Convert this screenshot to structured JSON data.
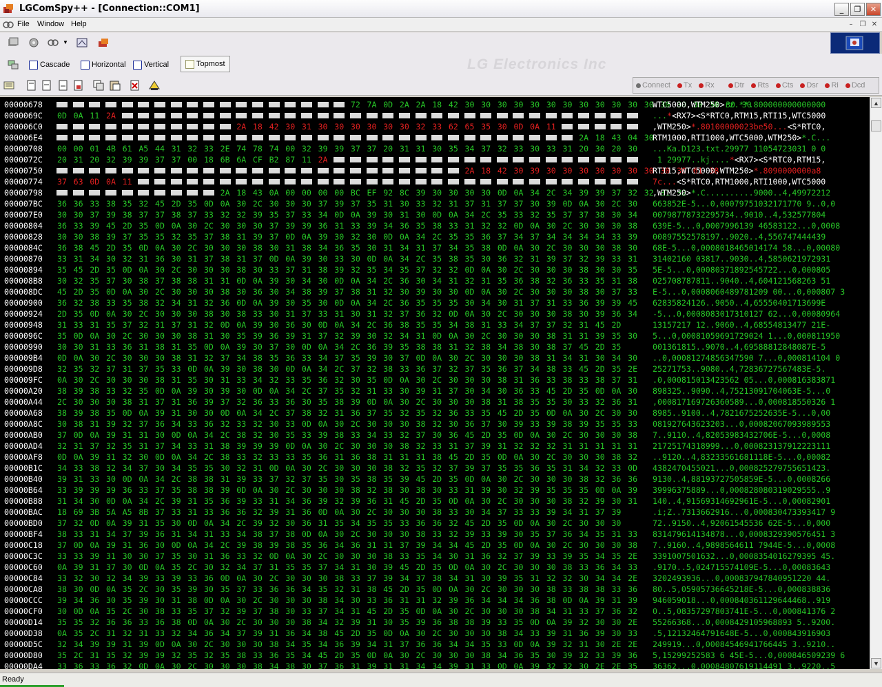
{
  "window": {
    "title": "LGComSpy++ - [Connection::COM1]"
  },
  "menu": {
    "items": [
      "File",
      "Window",
      "Help"
    ]
  },
  "toolbar2": {
    "cascade": "Cascade",
    "horizontal": "Horizontal",
    "vertical": "Vertical",
    "topmost": "Topmost",
    "watermark": "LG Electronics Inc"
  },
  "signals": [
    "Connect",
    "Tx",
    "Rx",
    "Dtr",
    "Rts",
    "Cts",
    "Dsr",
    "Ri",
    "Dcd"
  ],
  "status": {
    "text": "Ready"
  },
  "colors": {
    "hex_default": "#27c627",
    "hex_highlight": "#e32020",
    "offset": "#ffffff",
    "background": "#000000"
  },
  "terminal_rows": [
    {
      "offset": "00000678",
      "hex": "__ __ __ __ __ __ __ __ __ __ __ __ __ __ __ __ __ __ g72 g7A g0D g2A g2A g18 g42 g30 g30 g30 g30 g30 g30 g30 g30 g30 g30 g30 g30 g30 g30 g30 g30 g30 g30",
      "ascii": [
        {
          "t": "WTC5000,WTM250>",
          "c": "w"
        },
        {
          "t": "rz.**.800000000000000",
          "c": "g"
        }
      ]
    },
    {
      "offset": "0000069C",
      "hex": "g0D g0A g11 r2A __ __ __ __ __ __ __ __ __ __ __ __ __ __ __ __ __ __ __ __ __ __ __ __ __ __ __ __ __ __ __ __",
      "ascii": [
        {
          "t": "...",
          "c": "g"
        },
        {
          "t": "*",
          "c": "r"
        },
        {
          "t": "<RX7><S*RTC0,RTM15,RTI15,WTC5000",
          "c": "w"
        }
      ]
    },
    {
      "offset": "000006C0",
      "hex": "__ __ __ __ __ __ __ __ __ __ __ r2A r18 r42 r30 r31 r30 r30 r30 r30 r30 r30 r32 r33 r62 r65 r35 r30 r0D r0A r11 __ __ __ __ __",
      "ascii": [
        {
          "t": ",WTM250>",
          "c": "w"
        },
        {
          "t": "*.80100000023be50...",
          "c": "r"
        },
        {
          "t": "<S*RTC0,",
          "c": "w"
        }
      ]
    },
    {
      "offset": "000006E4",
      "hex": "__ __ __ __ __ __ __ __ __ __ __ __ __ __ __ __ __ __ __ __ __ __ __ __ __ __ __ __ __ __ __ __ g2A g18 g43 g04 g30",
      "ascii": [
        {
          "t": "RTM1000,RTI1000,WTC5000,WTM250>",
          "c": "w"
        },
        {
          "t": "*.C...",
          "c": "g"
        }
      ]
    },
    {
      "offset": "00000708",
      "hex": "g00 g00 g01 g4B g61 gA5 g44 g31 g32 g33 g2E g74 g78 g74 g00 g32 g39 g39 g37 g37 g20 g31 g31 g30 g35 g34 g37 g32 g33 g30 g33 g31 g20 g30 g20 g30",
      "ascii": [
        {
          "t": "...Ka.D123.txt.29977 11054723031 0 0",
          "c": "g"
        }
      ]
    },
    {
      "offset": "0000072C",
      "hex": "g20 g31 g20 g32 g39 g39 g37 g37 g00 g18 g6B g6A gCF gB2 g87 g11 r2A __ __ __ __ __ __ __ __ __ __ __ __ __ __ __ __ __ __ __",
      "ascii": [
        {
          "t": " 1 29977..kj....",
          "c": "g"
        },
        {
          "t": "*",
          "c": "r"
        },
        {
          "t": "<RX7><S*RTC0,RTM15,",
          "c": "w"
        }
      ]
    },
    {
      "offset": "00000750",
      "hex": "__ __ __ __ __ __ __ __ __ __ __ __ __ __ __ __ __ __ __ __ __ __ __ __ __ r2A r18 r42 r30 r39 r30 r30 r30 r30 r30 r30 r30 r30 r30 r61 r38",
      "ascii": [
        {
          "t": "RTI15,WTC5000,WTM250>",
          "c": "w"
        },
        {
          "t": "*.8090000000a8",
          "c": "r"
        }
      ]
    },
    {
      "offset": "00000774",
      "hex": "r37 r63 r0D r0A r11 __ __ __ __ __ __ __ __ __ __ __ __ __ __ __ __ __ __ __ __ __ __ __ __ __ __ __ __ __ __ __",
      "ascii": [
        {
          "t": "7c...",
          "c": "r"
        },
        {
          "t": "<S*RTC0,RTM1000,RTI1000,WTC5000",
          "c": "w"
        }
      ]
    },
    {
      "offset": "00000798",
      "hex": "__ __ __ __ __ __ __ __ __ __ g2A g18 g43 g0A g00 g00 g00 g00 gBC gEF g92 g8C g39 g30 g30 g30 g30 g0D g0A g34 g2C g34 g39 g39 g37 g32 g32 g31 g32",
      "ascii": [
        {
          "t": ",WTM250>",
          "c": "w"
        },
        {
          "t": "*.C..........9000..4,49972212",
          "c": "g"
        }
      ]
    },
    {
      "offset": "000007BC",
      "hex": "g36 g36 g33 g38 g35 g32 g45 g2D g35 g0D g0A g30 g2C g30 g30 g30 g37 g39 g37 g35 g31 g30 g33 g32 g31 g37 g31 g37 g37 g30 g39 g0D g0A g30 g2C g30",
      "ascii": [
        {
          "t": "663852E-5...0,00079751032171770 9..0,0",
          "c": "g"
        }
      ]
    },
    {
      "offset": "000007E0",
      "hex": "g30 g30 g37 g39 g38 g37 g37 g38 g37 g33 g32 g32 g39 g35 g37 g33 g34 g0D g0A g39 g30 g31 g30 g0D g0A g34 g2C g35 g33 g32 g35 g37 g37 g38 g30 g34",
      "ascii": [
        {
          "t": "00798778732295734..9010..4,532577804",
          "c": "g"
        }
      ]
    },
    {
      "offset": "00000804",
      "hex": "g36 g33 g39 g45 g2D g35 g0D g0A g30 g2C g30 g30 g30 g37 g39 g39 g36 g31 g33 g39 g34 g36 g35 g38 g33 g31 g32 g32 g0D g0A g30 g2C g30 g30 g30 g38",
      "ascii": [
        {
          "t": "639E-5...0,0007996139 46583122...0,0008",
          "c": "g"
        }
      ]
    },
    {
      "offset": "00000828",
      "hex": "g30 g30 g38 g39 g37 g35 g35 g32 g35 g37 g38 g31 g39 g37 g0D g0A g39 g30 g32 g30 g0D g0A g34 g2C g35 g35 g36 g37 g34 g37 g34 g34 g34 g34 g33 g39",
      "ascii": [
        {
          "t": "00897552578197..9020..4,556747444439",
          "c": "g"
        }
      ]
    },
    {
      "offset": "0000084C",
      "hex": "g36 g38 g45 g2D g35 g0D g0A g30 g2C g30 g30 g30 g38 g30 g31 g38 g34 g36 g35 g30 g31 g34 g31 g37 g34 g35 g38 g0D g0A g30 g2C g30 g30 g30 g38 g30",
      "ascii": [
        {
          "t": "68E-5...0,0008018465014174 58...0,00080",
          "c": "g"
        }
      ]
    },
    {
      "offset": "00000870",
      "hex": "g33 g31 g34 g30 g32 g31 g36 g30 g31 g37 g38 g31 g37 g0D g0A g39 g30 g33 g30 g0D g0A g34 g2C g35 g38 g35 g30 g36 g32 g31 g39 g37 g32 g39 g33 g31",
      "ascii": [
        {
          "t": "31402160 03817..9030..4,5850621972931",
          "c": "g"
        }
      ]
    },
    {
      "offset": "00000894",
      "hex": "g35 g45 g2D g35 g0D g0A g30 g2C g30 g30 g30 g38 g30 g33 g37 g31 g38 g39 g32 g35 g34 g35 g37 g32 g32 g0D g0A g30 g2C g30 g30 g30 g38 g30 g30 g35",
      "ascii": [
        {
          "t": "5E-5...0,00080371892545722...0,000805",
          "c": "g"
        }
      ]
    },
    {
      "offset": "000008B8",
      "hex": "g30 g32 g35 g37 g30 g38 g37 g38 g38 g31 g31 g0D g0A g39 g30 g34 g30 g0D g0A g34 g2C g36 g30 g34 g31 g32 g31 g35 g36 g38 g32 g36 g33 g35 g31 g38",
      "ascii": [
        {
          "t": "025708787811..9040..4,604121568263 51",
          "c": "g"
        }
      ]
    },
    {
      "offset": "000008DC",
      "hex": "g45 g2D g35 g0D g0A g30 g2C g30 g30 g30 g38 g30 g36 g30 g34 g38 g39 g37 g38 g31 g32 g30 g39 g30 g30 g0D g0A g30 g2C g30 g30 g30 g38 g30 g37 g33",
      "ascii": [
        {
          "t": "E-5...0,0008060489781209 00...0,000807 3",
          "c": "g"
        }
      ]
    },
    {
      "offset": "00000900",
      "hex": "g36 g32 g38 g33 g35 g38 g32 g34 g31 g32 g36 g0D g0A g39 g30 g35 g30 g0D g0A g34 g2C g36 g35 g35 g35 g30 g34 g30 g31 g37 g31 g33 g36 g39 g39 g45",
      "ascii": [
        {
          "t": "62835824126..9050..4,65550401713699E",
          "c": "g"
        }
      ]
    },
    {
      "offset": "00000924",
      "hex": "g2D g35 g0D g0A g30 g2C g30 g30 g30 g38 g30 g38 g33 g30 g31 g37 g33 g31 g30 g31 g32 g37 g36 g32 g0D g0A g30 g2C g30 g30 g30 g38 g30 g39 g36 g34",
      "ascii": [
        {
          "t": "-5...0,0008083017310127 62...0,00080964",
          "c": "g"
        }
      ]
    },
    {
      "offset": "00000948",
      "hex": "g31 g33 g31 g35 g37 g32 g31 g37 g31 g32 g0D g0A g39 g30 g36 g30 g0D g0A g34 g2C g36 g38 g35 g35 g34 g38 g31 g33 g34 g37 g37 g32 g31 g45 g2D",
      "ascii": [
        {
          "t": "13157217 12..9060..4,68554813477 21E-",
          "c": "g"
        }
      ]
    },
    {
      "offset": "0000096C",
      "hex": "g35 g0D g0A g30 g2C g30 g30 g30 g38 g31 g30 g35 g39 g36 g39 g31 g37 g32 g39 g30 g32 g34 g31 g0D g0A g30 g2C g30 g30 g30 g38 g31 g31 g39 g35 g30",
      "ascii": [
        {
          "t": "5...0,00081059691729024 1...0,000811950",
          "c": "g"
        }
      ]
    },
    {
      "offset": "00000990",
      "hex": "g30 g30 g31 g33 g36 g31 g38 g31 g35 g0D g0A g39 g30 g37 g30 g0D g0A g34 g2C g36 g39 g35 g38 g38 g31 g32 g38 g34 g38 g30 g38 g37 g45 g2D g35",
      "ascii": [
        {
          "t": "001361815..9070..4,69588812848087E-5",
          "c": "g"
        }
      ]
    },
    {
      "offset": "000009B4",
      "hex": "g0D g0A g30 g2C g30 g30 g30 g38 g31 g32 g37 g34 g38 g35 g36 g33 g34 g37 g35 g39 g30 g37 g0D g0A g30 g2C g30 g30 g30 g38 g31 g34 g31 g30 g34 g30",
      "ascii": [
        {
          "t": "..0,00081274856347590 7...0,000814104 0",
          "c": "g"
        }
      ]
    },
    {
      "offset": "000009D8",
      "hex": "g32 g35 g32 g37 g31 g37 g35 g33 g0D g0A g39 g30 g38 g30 g0D g0A g34 g2C g37 g32 g38 g33 g36 g37 g32 g37 g35 g36 g37 g34 g38 g33 g45 g2D g35 g2E",
      "ascii": [
        {
          "t": "25271753..9080..4,72836727567483E-5.",
          "c": "g"
        }
      ]
    },
    {
      "offset": "000009FC",
      "hex": "g0A g30 g2C g30 g30 g30 g38 g31 g35 g30 g31 g33 g34 g32 g33 g35 g36 g32 g30 g35 g0D g0A g30 g2C g30 g30 g30 g38 g31 g36 g33 g38 g33 g38 g37 g31",
      "ascii": [
        {
          "t": ".0,000815013423562 05...0,000816383871",
          "c": "g"
        }
      ]
    },
    {
      "offset": "00000A20",
      "hex": "g38 g39 g38 g33 g32 g35 g0D g0A g39 g30 g39 g30 g0D g0A g34 g2C g37 g35 g32 g31 g33 g30 g39 g31 g37 g30 g34 g30 g36 g33 g45 g2D g35 g0D g0A g30",
      "ascii": [
        {
          "t": "898325..9090..4,75213091704063E-5...0",
          "c": "g"
        }
      ]
    },
    {
      "offset": "00000A44",
      "hex": "g2C g30 g30 g30 g38 g31 g37 g31 g36 g39 g37 g32 g36 g33 g36 g30 g35 g38 g39 g0D g0A g30 g2C g30 g30 g30 g38 g31 g38 g35 g35 g30 g33 g32 g36 g31",
      "ascii": [
        {
          "t": ",000817169726360589...0,000818550326 1",
          "c": "g"
        }
      ]
    },
    {
      "offset": "00000A68",
      "hex": "g38 g39 g38 g35 g0D g0A g39 g31 g30 g30 g0D g0A g34 g2C g37 g38 g32 g31 g36 g37 g35 g32 g35 g32 g36 g33 g35 g45 g2D g35 g0D g0A g30 g2C g30 g30",
      "ascii": [
        {
          "t": "8985..9100..4,7821675252635E-5...0,00",
          "c": "g"
        }
      ]
    },
    {
      "offset": "00000A8C",
      "hex": "g30 g38 g31 g39 g32 g37 g36 g34 g33 g36 g32 g33 g32 g30 g33 g0D g0A g30 g2C g30 g30 g30 g38 g32 g30 g36 g37 g30 g39 g33 g39 g38 g39 g35 g35 g33",
      "ascii": [
        {
          "t": "081927643623203...0,00082067093989553",
          "c": "g"
        }
      ]
    },
    {
      "offset": "00000AB0",
      "hex": "g37 g0D g0A g39 g31 g31 g30 g0D g0A g34 g2C g38 g32 g30 g35 g33 g39 g38 g33 g34 g33 g32 g37 g30 g36 g45 g2D g35 g0D g0A g30 g2C g30 g30 g30 g38",
      "ascii": [
        {
          "t": "7..9110..4,82053983432706E-5...0,0008",
          "c": "g"
        }
      ]
    },
    {
      "offset": "00000AD4",
      "hex": "g32 g31 g37 g32 g35 g31 g37 g34 g33 g31 g38 g39 g39 g39 g0D g0A g30 g2C g30 g30 g30 g38 g32 g33 g31 g37 g39 g31 g32 g32 g32 g31 g31 g31 g31 g31",
      "ascii": [
        {
          "t": "21725174318999...0,000823137912223111",
          "c": "g"
        }
      ]
    },
    {
      "offset": "00000AF8",
      "hex": "g0D g0A g39 g31 g32 g30 g0D g0A g34 g2C g38 g33 g32 g33 g33 g35 g36 g31 g36 g38 g31 g31 g31 g38 g45 g2D g35 g0D g0A g30 g2C g30 g30 g30 g38 g32",
      "ascii": [
        {
          "t": "..9120..4,83233561681118E-5...0,00082",
          "c": "g"
        }
      ]
    },
    {
      "offset": "00000B1C",
      "hex": "g34 g33 g38 g32 g34 g37 g30 g34 g35 g35 g30 g32 g31 g0D g0A g30 g2C g30 g30 g30 g38 g32 g35 g32 g37 g39 g37 g35 g35 g36 g35 g31 g34 g32 g33 g0D",
      "ascii": [
        {
          "t": "4382470455021...0,000825279755651423.",
          "c": "g"
        }
      ]
    },
    {
      "offset": "00000B40",
      "hex": "g39 g31 g33 g30 g0D g0A g34 g2C g38 g38 g31 g39 g33 g37 g32 g37 g35 g30 g35 g38 g35 g39 g45 g2D g35 g0D g0A g30 g2C g30 g30 g30 g38 g32 g36 g36",
      "ascii": [
        {
          "t": "9130..4,88193727505859E-5...0,0008266",
          "c": "g"
        }
      ]
    },
    {
      "offset": "00000B64",
      "hex": "g33 g39 g39 g39 g36 g33 g37 g35 g38 g38 g39 g0D g0A g30 g2C g30 g30 g30 g38 g32 g38 g30 g38 g30 g33 g31 g39 g30 g32 g39 g35 g35 g35 g0D g0A g39",
      "ascii": [
        {
          "t": "39996375889...0,000828080319029555..9",
          "c": "g"
        }
      ]
    },
    {
      "offset": "00000B88",
      "hex": "g31 g34 g30 g0D g0A g34 g2C g39 g31 g35 g36 g39 g33 g31 g34 g36 g39 g32 g39 g36 g31 g45 g2D g35 g0D g0A g30 g2C g30 g30 g30 g38 g32 g39 g30 g31",
      "ascii": [
        {
          "t": "140..4,91569314692961E-5...0,00082901",
          "c": "g"
        }
      ]
    },
    {
      "offset": "00000BAC",
      "hex": "g18 g69 g3B g5A gA5 g8B g37 g33 g31 g33 g36 g36 g32 g39 g31 g36 g0D g0A g30 g2C g30 g30 g30 g38 g33 g30 g34 g37 g33 g33 g39 g34 g31 g37 g39",
      "ascii": [
        {
          "t": ".i;Z..7313662916...0,000830473393417 9",
          "c": "g"
        }
      ]
    },
    {
      "offset": "00000BD0",
      "hex": "g37 g32 g0D g0A g39 g31 g35 g30 g0D g0A g34 g2C g39 g32 g30 g36 g31 g35 g34 g35 g35 g33 g36 g36 g32 g45 g2D g35 g0D g0A g30 g2C g30 g30 g30",
      "ascii": [
        {
          "t": "72..9150..4,92061545536 62E-5...0,000",
          "c": "g"
        }
      ]
    },
    {
      "offset": "00000BF4",
      "hex": "g38 g33 g31 g34 g37 g39 g36 g31 g34 g31 g33 g34 g38 g37 g38 g0D g0A g30 g2C g30 g30 g30 g38 g33 g32 g39 g33 g39 g30 g35 g37 g36 g34 g35 g31 g33",
      "ascii": [
        {
          "t": "831479614134878...0,0008329390576451 3",
          "c": "g"
        }
      ]
    },
    {
      "offset": "00000C18",
      "hex": "g37 g0D g0A g39 g31 g36 g30 g0D g0A g34 g2C g39 g38 g39 g38 g35 g36 g34 g36 g31 g31 g37 g39 g34 g34 g45 g2D g35 g0D g0A g30 g2C g30 g30 g30 g38",
      "ascii": [
        {
          "t": "7..9160..4,9898564611 7944E-5...0,0008",
          "c": "g"
        }
      ]
    },
    {
      "offset": "00000C3C",
      "hex": "g33 g33 g39 g31 g30 g30 g37 g35 g30 g31 g36 g33 g32 g0D g0A g30 g2C g30 g30 g30 g38 g33 g35 g34 g30 g31 g36 g32 g37 g39 g33 g39 g35 g34 g35 g2E",
      "ascii": [
        {
          "t": "3391007501632...0,0008354016279395 45.",
          "c": "g"
        }
      ]
    },
    {
      "offset": "00000C60",
      "hex": "g0A g39 g31 g37 g30 g0D g0A g35 g2C g30 g32 g34 g37 g31 g35 g35 g37 g34 g31 g30 g39 g45 g2D g35 g0D g0A g30 g2C g30 g30 g30 g38 g33 g36 g34 g33",
      "ascii": [
        {
          "t": ".9170..5,024715574109E-5...0,00083643",
          "c": "g"
        }
      ]
    },
    {
      "offset": "00000C84",
      "hex": "g33 g32 g30 g32 g34 g39 g33 g39 g33 g36 g0D g0A g30 g2C g30 g30 g30 g38 g33 g37 g39 g34 g37 g38 g34 g31 g30 g39 g35 g31 g32 g32 g30 g34 g34 g2E",
      "ascii": [
        {
          "t": "3202493936...0,000837947840951220 44.",
          "c": "g"
        }
      ]
    },
    {
      "offset": "00000CA8",
      "hex": "g38 g30 g0D g0A g35 g2C g30 g35 g39 g30 g35 g37 g33 g36 g36 g34 g35 g32 g31 g38 g45 g2D g35 g0D g0A g30 g2C g30 g30 g30 g38 g33 g38 g38 g33 g36",
      "ascii": [
        {
          "t": "80..5,05905736645218E-5...0,000838836",
          "c": "g"
        }
      ]
    },
    {
      "offset": "00000CCC",
      "hex": "g39 g34 g36 g30 g35 g39 g30 g31 g38 g0D g0A g30 g2C g30 g30 g30 g38 g34 g30 g33 g36 g31 g31 g32 g39 g36 g34 g34 g34 g36 g38 g0D g0A g39 g31 g39",
      "ascii": [
        {
          "t": "946059018...0,000840361129644468..919",
          "c": "g"
        }
      ]
    },
    {
      "offset": "00000CF0",
      "hex": "g30 g0D g0A g35 g2C g30 g38 g33 g35 g37 g32 g39 g37 g38 g30 g33 g37 g34 g31 g45 g2D g35 g0D g0A g30 g2C g30 g30 g30 g38 g34 g31 g33 g37 g36 g32",
      "ascii": [
        {
          "t": "0..5,08357297803741E-5...0,000841376 2",
          "c": "g"
        }
      ]
    },
    {
      "offset": "00000D14",
      "hex": "g35 g35 g32 g36 g36 g33 g36 g38 g0D g0A g30 g2C g30 g30 g30 g38 g34 g32 g39 g31 g30 g35 g39 g36 g38 g38 g39 g33 g35 g0D g0A g39 g32 g30 g30 g2E",
      "ascii": [
        {
          "t": "55266368...0,0008429105968893 5..9200.",
          "c": "g"
        }
      ]
    },
    {
      "offset": "00000D38",
      "hex": "g0A g35 g2C g31 g32 g31 g33 g32 g34 g36 g34 g37 g39 g31 g36 g34 g38 g45 g2D g35 g0D g0A g30 g2C g30 g30 g30 g38 g34 g33 g39 g31 g36 g39 g30 g33",
      "ascii": [
        {
          "t": ".5,12132464791648E-5...0,000843916903",
          "c": "g"
        }
      ]
    },
    {
      "offset": "00000D5C",
      "hex": "g32 g34 g39 g39 g31 g39 g0D g0A g30 g2C g30 g30 g30 g38 g34 g35 g34 g36 g39 g34 g31 g37 g36 g36 g34 g34 g35 g33 g0D g0A g39 g32 g31 g30 g2E g2E",
      "ascii": [
        {
          "t": "249919...0,00084546941766445 3..9210..",
          "c": "g"
        }
      ]
    },
    {
      "offset": "00000D80",
      "hex": "g35 g2C g31 g35 g32 g39 g39 g32 g35 g32 g35 g38 g33 g36 g35 g34 g45 g2D g35 g0D g0A g30 g2C g30 g30 g30 g38 g34 g36 g35 g30 g39 g32 g33 g39 g36",
      "ascii": [
        {
          "t": "5,15299252583 6 45E-5...0,000846509239 6",
          "c": "g"
        }
      ]
    },
    {
      "offset": "00000DA4",
      "hex": "g33 g36 g33 g36 g32 g0D g0A g30 g2C g30 g30 g30 g38 g34 g38 g30 g37 g36 g31 g39 g31 g31 g34 g34 g39 g31 g33 g0D g0A g39 g32 g32 g30 g2E g2E g35",
      "ascii": [
        {
          "t": "36362...0,00084807619114491 3..9220..5",
          "c": "g"
        }
      ]
    }
  ]
}
